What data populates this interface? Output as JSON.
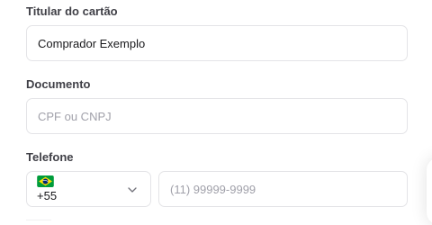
{
  "form": {
    "holder": {
      "label": "Titular do cartão",
      "value": "Comprador Exemplo"
    },
    "document": {
      "label": "Documento",
      "placeholder": "CPF ou CNPJ"
    },
    "phone": {
      "label": "Telefone",
      "country_icon": "brazil-flag-icon",
      "dial_code": "+55",
      "placeholder": "(11) 99999-9999"
    }
  },
  "colors": {
    "border": "#e4e4e7",
    "label": "#3f3f46",
    "text": "#18181b",
    "placeholder": "#a1a1aa",
    "flag_green": "#009c3b",
    "flag_yellow": "#ffdf00",
    "flag_blue": "#002776"
  }
}
